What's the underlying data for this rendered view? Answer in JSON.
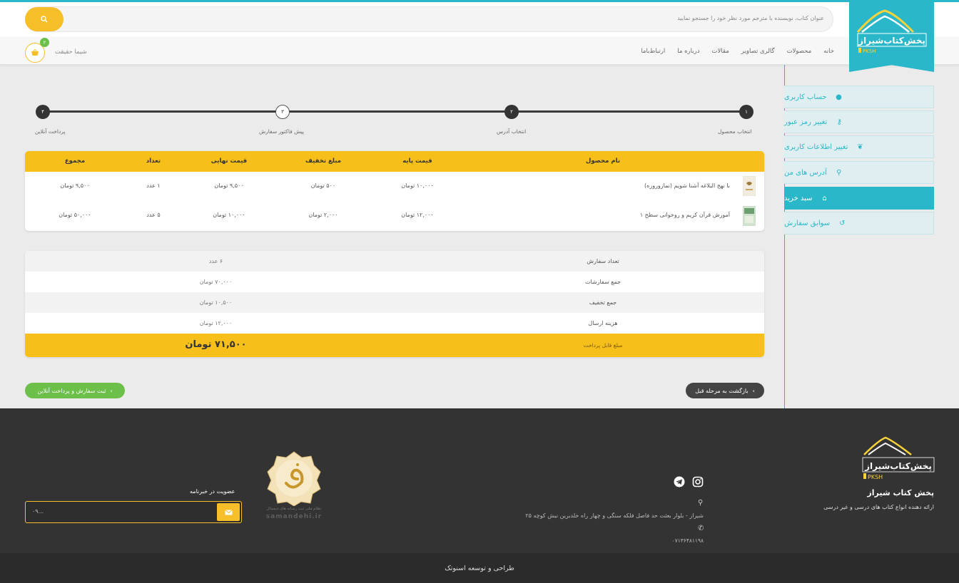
{
  "header": {
    "search_placeholder": "عنوان کتاب، نویسنده یا مترجم مورد نظر خود را جستجو نمایید",
    "nav": [
      "خانه",
      "محصولات",
      "گالری تصاویر",
      "مقالات",
      "درباره ما",
      "ارتباط‌باما"
    ],
    "user_name": "شیما حقیقت",
    "cart_count": "۲",
    "logo_text": "پخش‌کتاب‌شیراز",
    "logo_sub": "PKSH"
  },
  "sidebar": {
    "items": [
      {
        "label": "حساب کاربری",
        "icon": "user-icon"
      },
      {
        "label": "تغییر رمز عبور",
        "icon": "key-icon"
      },
      {
        "label": "تغییر اطلاعات کاربری",
        "icon": "leaf-icon"
      },
      {
        "label": "آدرس های من",
        "icon": "location-icon"
      },
      {
        "label": "سبد خرید",
        "icon": "basket-icon"
      },
      {
        "label": "سوابق سفارش",
        "icon": "history-icon"
      }
    ]
  },
  "steps": [
    {
      "num": "۱",
      "label": "انتخاب محصول"
    },
    {
      "num": "۲",
      "label": "انتخاب آدرس"
    },
    {
      "num": "۳",
      "label": "پیش فاکتور سفارش"
    },
    {
      "num": "۴",
      "label": "پرداخت آنلاین"
    }
  ],
  "table": {
    "headers": {
      "name": "نام محصول",
      "base": "قیمت پایه",
      "discount": "مبلغ تخفیف",
      "final": "قیمت نهایی",
      "qty": "تعداد",
      "total": "مجموع"
    },
    "rows": [
      {
        "name": "با نهج البلاغه آشنا شویم (نمازوروزه)",
        "base": "۱۰,۰۰۰ تومان",
        "discount": "۵۰۰ تومان",
        "final": "۹,۵۰۰ تومان",
        "qty": "۱ عدد",
        "total": "۹,۵۰۰ تومان"
      },
      {
        "name": "آموزش قرآن کریم و روخوانی سطح ۱",
        "base": "۱۲,۰۰۰ تومان",
        "discount": "۲,۰۰۰ تومان",
        "final": "۱۰,۰۰۰ تومان",
        "qty": "۵ عدد",
        "total": "۵۰,۰۰۰ تومان"
      }
    ]
  },
  "summary": {
    "rows": [
      {
        "label": "تعداد سفارش",
        "value": "۶ عدد"
      },
      {
        "label": "جمع سفارشات",
        "value": "۷۰,۰۰۰ تومان"
      },
      {
        "label": "جمع تخفیف",
        "value": "۱۰,۵۰۰ تومان"
      },
      {
        "label": "هزینه ارسال",
        "value": "۱۲,۰۰۰ تومان"
      }
    ],
    "payable_label": "مبلغ قابل پرداخت",
    "payable_value": "۷۱,۵۰۰ تومان"
  },
  "buttons": {
    "back": "بازگشت به مرحله قبل",
    "pay": "ثبت سفارش و پرداخت آنلاین"
  },
  "footer": {
    "company": "پخش کتاب شیراز",
    "tagline": "ارائه دهنده انواع کتاب های درسی و غیر درسی",
    "address": "شیراز - بلوار بعثت حد فاصل فلکه سنگی و چهار راه خلدبرین نبش کوچه ۲۵",
    "phone": "۰۷۱۳۶۴۸۱۱۹۸",
    "newsletter_label": "عضویت در خبرنامه",
    "newsletter_value": "۰۹...",
    "seal_text": "نظام ملی ثبت رسانه های دیجیتال",
    "seal_domain": "samandehi.ir",
    "credit": "طراحی و توسعه اسنوتک"
  },
  "colors": {
    "accent": "#2ab7c9",
    "yellow": "#f6bf19",
    "green": "#6cc04a",
    "dark": "#333333"
  }
}
